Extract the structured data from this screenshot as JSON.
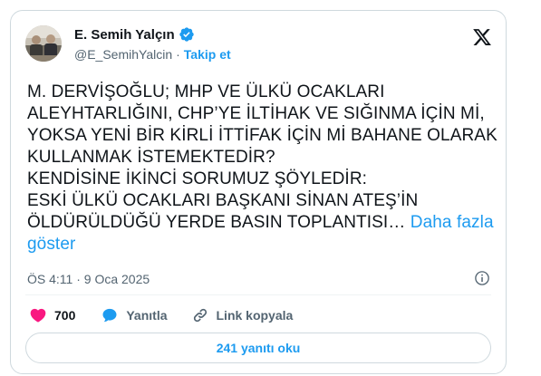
{
  "author": {
    "display_name": "E. Semih Yalçın",
    "handle": "@E_SemihYalcin",
    "separator": "·",
    "follow_label": "Takip et",
    "verified_icon": "verified-badge-icon"
  },
  "tweet": {
    "lines": [
      "M. DERVİŞOĞLU; MHP VE ÜLKÜ OCAKLARI",
      "ALEYHTARLIĞINI, CHP’YE İLTİHAK VE SIĞINMA İÇİN Mİ,",
      "YOKSA YENİ BİR KİRLİ İTTİFAK İÇİN Mİ BAHANE OLARAK",
      "KULLANMAK İSTEMEKTEDİR?",
      "KENDİSİNE İKİNCİ SORUMUZ ŞÖYLEDİR:",
      "ESKİ ÜLKÜ OCAKLARI BAŞKANI SİNAN ATEŞ’İN"
    ],
    "last_line": "ÖLDÜRÜLDÜĞÜ YERDE BASIN TOPLANTISI…",
    "more_label_1": "Daha fazla",
    "more_label_2": "göster"
  },
  "meta": {
    "timestamp": "ÖS 4:11 · 9 Oca 2025"
  },
  "actions": {
    "likes": "700",
    "reply_label": "Yanıtla",
    "copy_link_label": "Link kopyala"
  },
  "replies_button": "241 yanıtı oku",
  "colors": {
    "accent": "#1d9bf0",
    "like": "#f91880",
    "text": "#0f1419",
    "muted": "#536471",
    "border": "#cfd9de"
  }
}
